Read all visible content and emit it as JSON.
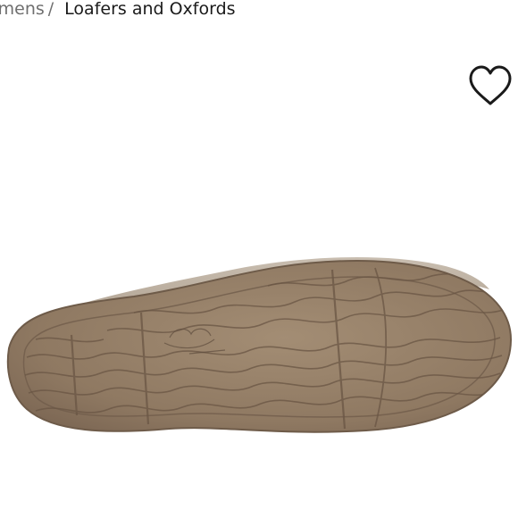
{
  "breadcrumb": {
    "parent": "omens",
    "separator": "/",
    "current": "Loafers and Oxfords"
  },
  "favorite": {
    "icon": "heart-outline-icon"
  },
  "product_image": {
    "subject": "shoe-sole",
    "sole_color": "#8f7962"
  },
  "colors": {
    "text_primary": "#1a1a1a",
    "text_secondary": "#6f6f6f",
    "background": "#ffffff"
  }
}
